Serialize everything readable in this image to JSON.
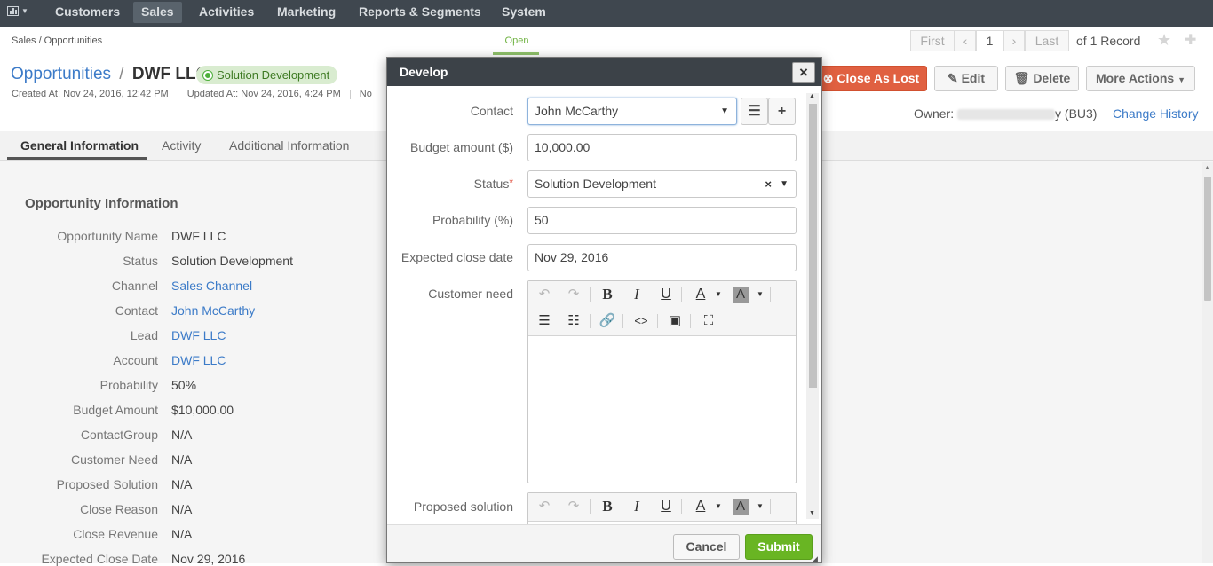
{
  "nav": {
    "items": [
      "Customers",
      "Sales",
      "Activities",
      "Marketing",
      "Reports & Segments",
      "System"
    ],
    "active": "Sales"
  },
  "breadcrumb": "Sales / Opportunities",
  "workflow_step": "Open",
  "pager": {
    "first": "First",
    "page": "1",
    "last": "Last",
    "total": "of 1 Record"
  },
  "title": {
    "entity": "Opportunities",
    "separator": "/",
    "name": "DWF LLC",
    "status": "Solution Development"
  },
  "meta": {
    "created": "Created At: Nov 24, 2016, 12:42 PM",
    "updated": "Updated At: Nov 24, 2016, 4:24 PM",
    "truncated": "No"
  },
  "actions": {
    "close_lost": "Close As Lost",
    "edit": "Edit",
    "delete": "Delete",
    "more": "More Actions"
  },
  "owner": {
    "label": "Owner:",
    "suffix": "y (BU3)"
  },
  "change_history": "Change History",
  "tabs": [
    "General Information",
    "Activity",
    "Additional Information"
  ],
  "section_title": "Opportunity Information",
  "fields": [
    {
      "label": "Opportunity Name",
      "value": "DWF LLC",
      "link": false
    },
    {
      "label": "Status",
      "value": "Solution Development",
      "link": false
    },
    {
      "label": "Channel",
      "value": "Sales Channel",
      "link": true
    },
    {
      "label": "Contact",
      "value": "John McCarthy",
      "link": true
    },
    {
      "label": "Lead",
      "value": "DWF LLC",
      "link": true
    },
    {
      "label": "Account",
      "value": "DWF LLC",
      "link": true
    },
    {
      "label": "Probability",
      "value": "50%",
      "link": false
    },
    {
      "label": "Budget Amount",
      "value": "$10,000.00",
      "link": false
    },
    {
      "label": "ContactGroup",
      "value": "N/A",
      "link": false
    },
    {
      "label": "Customer Need",
      "value": "N/A",
      "link": false
    },
    {
      "label": "Proposed Solution",
      "value": "N/A",
      "link": false
    },
    {
      "label": "Close Reason",
      "value": "N/A",
      "link": false
    },
    {
      "label": "Close Revenue",
      "value": "N/A",
      "link": false
    },
    {
      "label": "Expected Close Date",
      "value": "Nov 29, 2016",
      "link": false
    }
  ],
  "modal": {
    "title": "Develop",
    "close": "×",
    "contact_label": "Contact",
    "contact_value": "John McCarthy",
    "budget_label": "Budget amount ($)",
    "budget_value": "10,000.00",
    "status_label": "Status",
    "status_required": "*",
    "status_value": "Solution Development",
    "probability_label": "Probability (%)",
    "probability_value": "50",
    "close_date_label": "Expected close date",
    "close_date_value": "Nov 29, 2016",
    "customer_need_label": "Customer need",
    "proposed_solution_label": "Proposed solution",
    "cancel": "Cancel",
    "submit": "Submit"
  },
  "colors": {
    "nav_bg": "#3f474f",
    "link": "#3c7bc8",
    "danger": "#e06041",
    "success": "#69b523",
    "status_pill": "#d9ecd0"
  }
}
